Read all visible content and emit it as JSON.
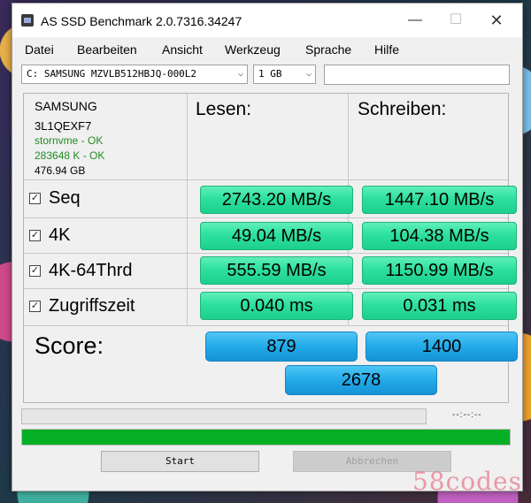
{
  "window": {
    "title": "AS SSD Benchmark 2.0.7316.34247",
    "min_symbol": "—",
    "max_symbol": "☐",
    "close_symbol": "✕"
  },
  "menu": [
    "Datei",
    "Bearbeiten",
    "Ansicht",
    "Werkzeug",
    "Sprache",
    "Hilfe"
  ],
  "toolbar": {
    "drive": "C: SAMSUNG MZVLB512HBJQ-000L2",
    "size": "1 GB",
    "path": ""
  },
  "drive_info": {
    "vendor": "SAMSUNG",
    "firmware": "3L1QEXF7",
    "driver": "stornvme - OK",
    "alignment": "283648 K - OK",
    "capacity": "476.94 GB"
  },
  "headers": {
    "read": "Lesen:",
    "write": "Schreiben:"
  },
  "tests": [
    {
      "label": "Seq",
      "checked": true,
      "read": "2743.20 MB/s",
      "write": "1447.10 MB/s"
    },
    {
      "label": "4K",
      "checked": true,
      "read": "49.04 MB/s",
      "write": "104.38 MB/s"
    },
    {
      "label": "4K-64Thrd",
      "checked": true,
      "read": "555.59 MB/s",
      "write": "1150.99 MB/s"
    },
    {
      "label": "Zugriffszeit",
      "checked": true,
      "read": "0.040 ms",
      "write": "0.031 ms"
    }
  ],
  "score": {
    "label": "Score:",
    "read": "879",
    "write": "1400",
    "total": "2678"
  },
  "status": {
    "time": "--:--:--",
    "progress_percent": 100
  },
  "buttons": {
    "start": "Start",
    "abort": "Abbrechen"
  },
  "watermark": "58codes",
  "colors": {
    "result_green": "#2ee0a0",
    "score_blue": "#22aae8",
    "progress_green": "#06b025",
    "info_green": "#228b22"
  }
}
